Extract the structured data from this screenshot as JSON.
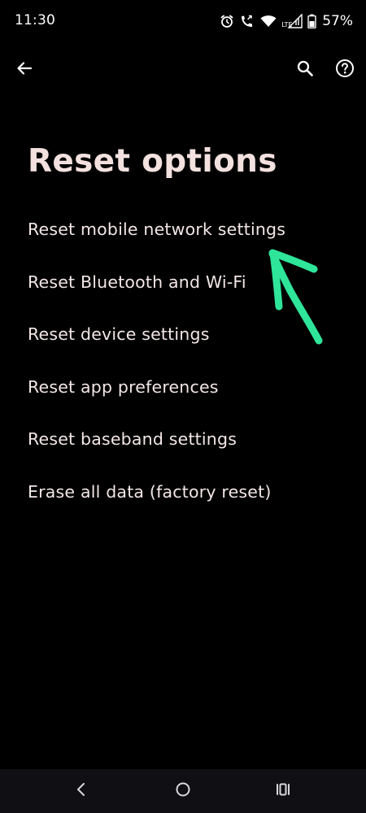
{
  "status_bar": {
    "time": "11:30",
    "lte_label": "LTE",
    "battery_percent": "57%",
    "icons": [
      "alarm-icon",
      "wifi-calling-icon",
      "wifi-icon",
      "cellular-signal-icon",
      "battery-icon"
    ]
  },
  "app_bar": {
    "icons": [
      "back-arrow-icon",
      "search-icon",
      "help-icon"
    ]
  },
  "page": {
    "title": "Reset options"
  },
  "options": [
    {
      "label": "Reset mobile network settings"
    },
    {
      "label": "Reset Bluetooth and Wi-Fi"
    },
    {
      "label": "Reset device settings"
    },
    {
      "label": "Reset app preferences"
    },
    {
      "label": "Reset baseband settings"
    },
    {
      "label": "Erase all data (factory reset)"
    }
  ],
  "annotation": {
    "color": "#2ee59a",
    "icon": "arrow-annotation-icon"
  },
  "nav_bar": {
    "icons": [
      "nav-back-icon",
      "nav-home-icon",
      "nav-recents-icon"
    ]
  },
  "colors": {
    "background": "#000000",
    "text": "#f3e6e6",
    "nav_bar": "#101014"
  }
}
